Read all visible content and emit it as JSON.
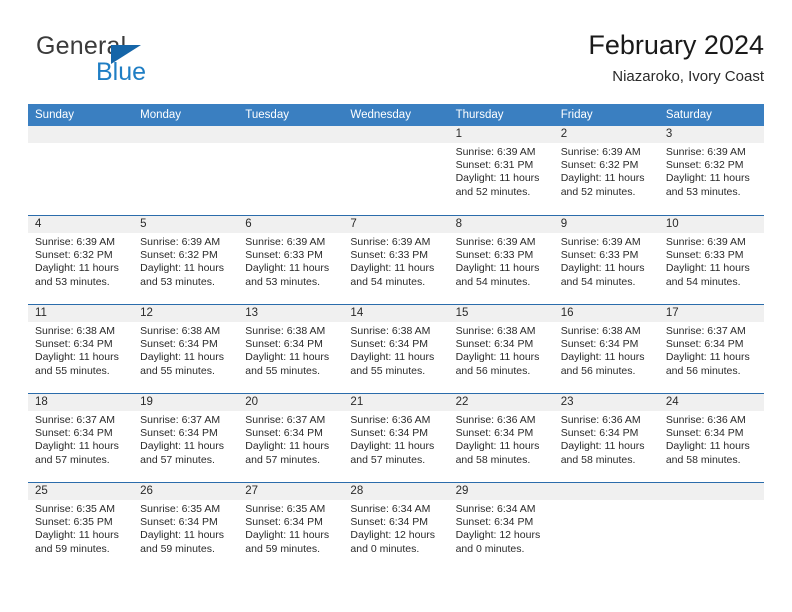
{
  "brand": {
    "name_part1": "General",
    "name_part2": "Blue",
    "triangle_color": "#1565a8",
    "blue_color": "#1f7ec4"
  },
  "header": {
    "title": "February 2024",
    "subtitle": "Niazaroko, Ivory Coast"
  },
  "theme": {
    "header_blue": "#3a7fc1",
    "row_border_blue": "#2b6cab",
    "day_band_gray": "#f0f0f0"
  },
  "weekdays": [
    "Sunday",
    "Monday",
    "Tuesday",
    "Wednesday",
    "Thursday",
    "Friday",
    "Saturday"
  ],
  "labels": {
    "sunrise_prefix": "Sunrise:",
    "sunset_prefix": "Sunset:",
    "daylight_prefix": "Daylight:"
  },
  "weeks": [
    [
      {
        "day": "",
        "empty": true
      },
      {
        "day": "",
        "empty": true
      },
      {
        "day": "",
        "empty": true
      },
      {
        "day": "",
        "empty": true
      },
      {
        "day": "1",
        "sunrise": "Sunrise: 6:39 AM",
        "sunset": "Sunset: 6:31 PM",
        "daylight": "Daylight: 11 hours and 52 minutes."
      },
      {
        "day": "2",
        "sunrise": "Sunrise: 6:39 AM",
        "sunset": "Sunset: 6:32 PM",
        "daylight": "Daylight: 11 hours and 52 minutes."
      },
      {
        "day": "3",
        "sunrise": "Sunrise: 6:39 AM",
        "sunset": "Sunset: 6:32 PM",
        "daylight": "Daylight: 11 hours and 53 minutes."
      }
    ],
    [
      {
        "day": "4",
        "sunrise": "Sunrise: 6:39 AM",
        "sunset": "Sunset: 6:32 PM",
        "daylight": "Daylight: 11 hours and 53 minutes."
      },
      {
        "day": "5",
        "sunrise": "Sunrise: 6:39 AM",
        "sunset": "Sunset: 6:32 PM",
        "daylight": "Daylight: 11 hours and 53 minutes."
      },
      {
        "day": "6",
        "sunrise": "Sunrise: 6:39 AM",
        "sunset": "Sunset: 6:33 PM",
        "daylight": "Daylight: 11 hours and 53 minutes."
      },
      {
        "day": "7",
        "sunrise": "Sunrise: 6:39 AM",
        "sunset": "Sunset: 6:33 PM",
        "daylight": "Daylight: 11 hours and 54 minutes."
      },
      {
        "day": "8",
        "sunrise": "Sunrise: 6:39 AM",
        "sunset": "Sunset: 6:33 PM",
        "daylight": "Daylight: 11 hours and 54 minutes."
      },
      {
        "day": "9",
        "sunrise": "Sunrise: 6:39 AM",
        "sunset": "Sunset: 6:33 PM",
        "daylight": "Daylight: 11 hours and 54 minutes."
      },
      {
        "day": "10",
        "sunrise": "Sunrise: 6:39 AM",
        "sunset": "Sunset: 6:33 PM",
        "daylight": "Daylight: 11 hours and 54 minutes."
      }
    ],
    [
      {
        "day": "11",
        "sunrise": "Sunrise: 6:38 AM",
        "sunset": "Sunset: 6:34 PM",
        "daylight": "Daylight: 11 hours and 55 minutes."
      },
      {
        "day": "12",
        "sunrise": "Sunrise: 6:38 AM",
        "sunset": "Sunset: 6:34 PM",
        "daylight": "Daylight: 11 hours and 55 minutes."
      },
      {
        "day": "13",
        "sunrise": "Sunrise: 6:38 AM",
        "sunset": "Sunset: 6:34 PM",
        "daylight": "Daylight: 11 hours and 55 minutes."
      },
      {
        "day": "14",
        "sunrise": "Sunrise: 6:38 AM",
        "sunset": "Sunset: 6:34 PM",
        "daylight": "Daylight: 11 hours and 55 minutes."
      },
      {
        "day": "15",
        "sunrise": "Sunrise: 6:38 AM",
        "sunset": "Sunset: 6:34 PM",
        "daylight": "Daylight: 11 hours and 56 minutes."
      },
      {
        "day": "16",
        "sunrise": "Sunrise: 6:38 AM",
        "sunset": "Sunset: 6:34 PM",
        "daylight": "Daylight: 11 hours and 56 minutes."
      },
      {
        "day": "17",
        "sunrise": "Sunrise: 6:37 AM",
        "sunset": "Sunset: 6:34 PM",
        "daylight": "Daylight: 11 hours and 56 minutes."
      }
    ],
    [
      {
        "day": "18",
        "sunrise": "Sunrise: 6:37 AM",
        "sunset": "Sunset: 6:34 PM",
        "daylight": "Daylight: 11 hours and 57 minutes."
      },
      {
        "day": "19",
        "sunrise": "Sunrise: 6:37 AM",
        "sunset": "Sunset: 6:34 PM",
        "daylight": "Daylight: 11 hours and 57 minutes."
      },
      {
        "day": "20",
        "sunrise": "Sunrise: 6:37 AM",
        "sunset": "Sunset: 6:34 PM",
        "daylight": "Daylight: 11 hours and 57 minutes."
      },
      {
        "day": "21",
        "sunrise": "Sunrise: 6:36 AM",
        "sunset": "Sunset: 6:34 PM",
        "daylight": "Daylight: 11 hours and 57 minutes."
      },
      {
        "day": "22",
        "sunrise": "Sunrise: 6:36 AM",
        "sunset": "Sunset: 6:34 PM",
        "daylight": "Daylight: 11 hours and 58 minutes."
      },
      {
        "day": "23",
        "sunrise": "Sunrise: 6:36 AM",
        "sunset": "Sunset: 6:34 PM",
        "daylight": "Daylight: 11 hours and 58 minutes."
      },
      {
        "day": "24",
        "sunrise": "Sunrise: 6:36 AM",
        "sunset": "Sunset: 6:34 PM",
        "daylight": "Daylight: 11 hours and 58 minutes."
      }
    ],
    [
      {
        "day": "25",
        "sunrise": "Sunrise: 6:35 AM",
        "sunset": "Sunset: 6:35 PM",
        "daylight": "Daylight: 11 hours and 59 minutes."
      },
      {
        "day": "26",
        "sunrise": "Sunrise: 6:35 AM",
        "sunset": "Sunset: 6:34 PM",
        "daylight": "Daylight: 11 hours and 59 minutes."
      },
      {
        "day": "27",
        "sunrise": "Sunrise: 6:35 AM",
        "sunset": "Sunset: 6:34 PM",
        "daylight": "Daylight: 11 hours and 59 minutes."
      },
      {
        "day": "28",
        "sunrise": "Sunrise: 6:34 AM",
        "sunset": "Sunset: 6:34 PM",
        "daylight": "Daylight: 12 hours and 0 minutes."
      },
      {
        "day": "29",
        "sunrise": "Sunrise: 6:34 AM",
        "sunset": "Sunset: 6:34 PM",
        "daylight": "Daylight: 12 hours and 0 minutes."
      },
      {
        "day": "",
        "empty": true
      },
      {
        "day": "",
        "empty": true
      }
    ]
  ]
}
